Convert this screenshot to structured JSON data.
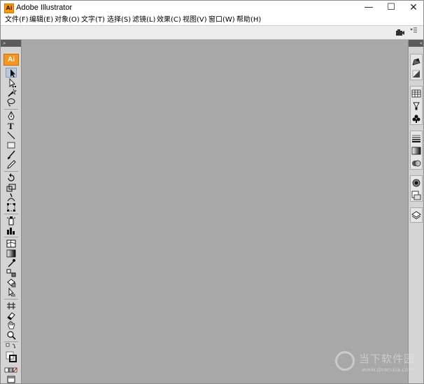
{
  "window": {
    "title": "Adobe Illustrator",
    "icon_label": "Ai",
    "controls": {
      "minimize": "—",
      "maximize": "☐",
      "close": "✕"
    }
  },
  "menu": [
    {
      "label": "文件(F)"
    },
    {
      "label": "编辑(E)"
    },
    {
      "label": "对象(O)"
    },
    {
      "label": "文字(T)"
    },
    {
      "label": "选择(S)"
    },
    {
      "label": "滤镜(L)"
    },
    {
      "label": "效果(C)"
    },
    {
      "label": "视图(V)"
    },
    {
      "label": "窗口(W)"
    },
    {
      "label": "帮助(H)"
    }
  ],
  "tools_panel": {
    "collapse_glyph": "»",
    "logo_label": "Ai",
    "tools": [
      "selection-tool",
      "direct-selection-tool",
      "magic-wand-tool",
      "lasso-tool",
      "pen-tool",
      "type-tool",
      "line-segment-tool",
      "rectangle-tool",
      "paintbrush-tool",
      "pencil-tool",
      "rotate-tool",
      "scale-tool",
      "warp-tool",
      "free-transform-tool",
      "symbol-sprayer-tool",
      "column-graph-tool",
      "mesh-tool",
      "gradient-tool",
      "eyedropper-tool",
      "blend-tool",
      "live-paint-bucket-tool",
      "live-paint-selection-tool",
      "slice-tool",
      "eraser-tool",
      "hand-tool",
      "zoom-tool",
      "fill-stroke-swap",
      "default-fill-stroke",
      "fill-stroke-color-swatches",
      "screen-mode-button"
    ]
  },
  "right_dock": {
    "collapse_glyph": "«",
    "panels": [
      "color-panel-icon",
      "color-guide-icon",
      "swatches-icon",
      "brushes-icon",
      "symbols-icon",
      "stroke-icon",
      "gradient-icon",
      "transparency-icon",
      "appearance-icon",
      "graphic-styles-icon",
      "layers-icon"
    ]
  },
  "watermark": {
    "title": "当下软件园",
    "url": "www.downxia.com"
  },
  "colors": {
    "workspace": "#a8a8a8",
    "panel": "#d4d4d4",
    "panel_header": "#5c5c5c",
    "accent": "#f7941d"
  }
}
